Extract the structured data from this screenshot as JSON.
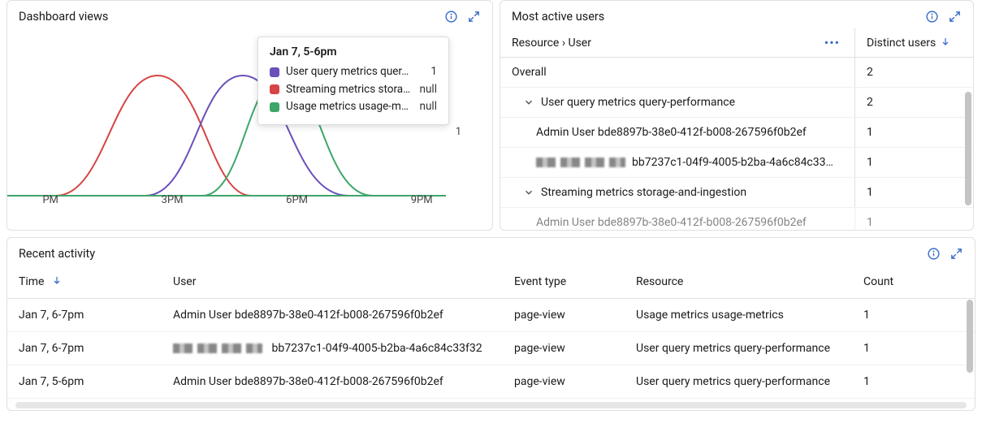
{
  "dashboard_views": {
    "title": "Dashboard views",
    "chart_data": {
      "type": "line",
      "xlabel": "",
      "ylabel": "",
      "ylim": [
        0,
        1
      ],
      "yticks": [
        1
      ],
      "xticks": [
        "PM",
        "3PM",
        "6PM",
        "9PM"
      ],
      "series": [
        {
          "name": "User query metrics query-performance",
          "color": "#6b4fbb"
        },
        {
          "name": "Streaming metrics storage-and-ingestion",
          "color": "#d64545"
        },
        {
          "name": "Usage metrics usage-metrics",
          "color": "#3fa66a"
        }
      ]
    },
    "tooltip": {
      "title": "Jan 7, 5-6pm",
      "rows": [
        {
          "color": "#6b4fbb",
          "label": "User query metrics quer…",
          "value": "1"
        },
        {
          "color": "#d64545",
          "label": "Streaming metrics stora…",
          "value": "null"
        },
        {
          "color": "#3fa66a",
          "label": "Usage metrics usage-m…",
          "value": "null"
        }
      ]
    }
  },
  "active_users": {
    "title": "Most active users",
    "col_resource": "Resource › User",
    "col_distinct": "Distinct users",
    "rows": [
      {
        "level": 0,
        "expandable": false,
        "label": "Overall",
        "value": "2"
      },
      {
        "level": 1,
        "expandable": true,
        "label": "User query metrics query-performance",
        "value": "2"
      },
      {
        "level": 2,
        "expandable": false,
        "label": "Admin User bde8897b-38e0-412f-b008-267596f0b2ef",
        "value": "1"
      },
      {
        "level": 2,
        "expandable": false,
        "redacted": true,
        "label": "bb7237c1-04f9-4005-b2ba-4a6c84c33…",
        "value": "1"
      },
      {
        "level": 1,
        "expandable": true,
        "label": "Streaming metrics storage-and-ingestion",
        "value": "1"
      },
      {
        "level": 2,
        "expandable": false,
        "label": "Admin User bde8897b-38e0-412f-b008-267596f0b2ef",
        "value": "1"
      }
    ]
  },
  "recent": {
    "title": "Recent activity",
    "columns": {
      "time": "Time",
      "user": "User",
      "event": "Event type",
      "resource": "Resource",
      "count": "Count"
    },
    "rows": [
      {
        "time": "Jan 7, 6-7pm",
        "user": "Admin User bde8897b-38e0-412f-b008-267596f0b2ef",
        "redacted": false,
        "event": "page-view",
        "resource": "Usage metrics usage-metrics",
        "count": "1"
      },
      {
        "time": "Jan 7, 6-7pm",
        "user": "bb7237c1-04f9-4005-b2ba-4a6c84c33f32",
        "redacted": true,
        "event": "page-view",
        "resource": "User query metrics query-performance",
        "count": "1"
      },
      {
        "time": "Jan 7, 5-6pm",
        "user": "Admin User bde8897b-38e0-412f-b008-267596f0b2ef",
        "redacted": false,
        "event": "page-view",
        "resource": "User query metrics query-performance",
        "count": "1"
      }
    ]
  }
}
